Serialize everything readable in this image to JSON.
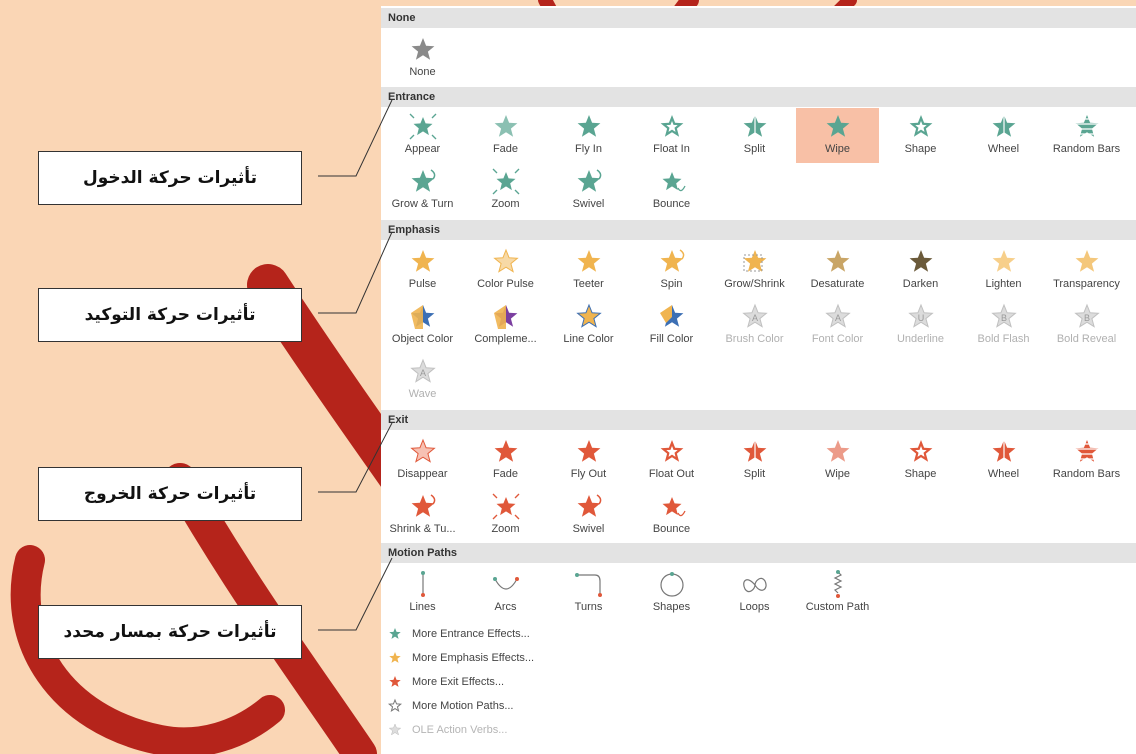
{
  "colors": {
    "entrance": "#5aa592",
    "emphasis": "#f0b44f",
    "exit": "#e0583a",
    "disabled": "#c8c8c8",
    "selected": "#f8c0a6",
    "watermark": "#b5241b"
  },
  "sections": {
    "none": {
      "title": "None",
      "items": [
        {
          "label": "None",
          "icon": "star-none-icon"
        }
      ]
    },
    "entrance": {
      "title": "Entrance",
      "items": [
        {
          "label": "Appear",
          "icon": "appear-icon"
        },
        {
          "label": "Fade",
          "icon": "fade-icon"
        },
        {
          "label": "Fly In",
          "icon": "fly-in-icon"
        },
        {
          "label": "Float In",
          "icon": "float-in-icon"
        },
        {
          "label": "Split",
          "icon": "split-icon"
        },
        {
          "label": "Wipe",
          "icon": "wipe-icon",
          "selected": true
        },
        {
          "label": "Shape",
          "icon": "shape-icon"
        },
        {
          "label": "Wheel",
          "icon": "wheel-icon"
        },
        {
          "label": "Random Bars",
          "icon": "random-bars-icon"
        },
        {
          "label": "Grow & Turn",
          "icon": "grow-turn-icon"
        },
        {
          "label": "Zoom",
          "icon": "zoom-icon"
        },
        {
          "label": "Swivel",
          "icon": "swivel-icon"
        },
        {
          "label": "Bounce",
          "icon": "bounce-icon"
        }
      ]
    },
    "emphasis": {
      "title": "Emphasis",
      "items": [
        {
          "label": "Pulse",
          "icon": "pulse-icon"
        },
        {
          "label": "Color Pulse",
          "icon": "color-pulse-icon"
        },
        {
          "label": "Teeter",
          "icon": "teeter-icon"
        },
        {
          "label": "Spin",
          "icon": "spin-icon"
        },
        {
          "label": "Grow/Shrink",
          "icon": "grow-shrink-icon"
        },
        {
          "label": "Desaturate",
          "icon": "desaturate-icon"
        },
        {
          "label": "Darken",
          "icon": "darken-icon"
        },
        {
          "label": "Lighten",
          "icon": "lighten-icon"
        },
        {
          "label": "Transparency",
          "icon": "transparency-icon"
        },
        {
          "label": "Object Color",
          "icon": "object-color-icon"
        },
        {
          "label": "Compleme...",
          "icon": "complementary-color-icon"
        },
        {
          "label": "Line Color",
          "icon": "line-color-icon"
        },
        {
          "label": "Fill Color",
          "icon": "fill-color-icon"
        },
        {
          "label": "Brush Color",
          "icon": "brush-color-icon",
          "disabled": true,
          "glyph": "A"
        },
        {
          "label": "Font Color",
          "icon": "font-color-icon",
          "disabled": true,
          "glyph": "A"
        },
        {
          "label": "Underline",
          "icon": "underline-icon",
          "disabled": true,
          "glyph": "U"
        },
        {
          "label": "Bold Flash",
          "icon": "bold-flash-icon",
          "disabled": true,
          "glyph": "B"
        },
        {
          "label": "Bold Reveal",
          "icon": "bold-reveal-icon",
          "disabled": true,
          "glyph": "B"
        },
        {
          "label": "Wave",
          "icon": "wave-icon",
          "disabled": true,
          "glyph": "A"
        }
      ]
    },
    "exit": {
      "title": "Exit",
      "items": [
        {
          "label": "Disappear",
          "icon": "disappear-icon"
        },
        {
          "label": "Fade",
          "icon": "fade-exit-icon"
        },
        {
          "label": "Fly Out",
          "icon": "fly-out-icon"
        },
        {
          "label": "Float Out",
          "icon": "float-out-icon"
        },
        {
          "label": "Split",
          "icon": "split-exit-icon"
        },
        {
          "label": "Wipe",
          "icon": "wipe-exit-icon"
        },
        {
          "label": "Shape",
          "icon": "shape-exit-icon"
        },
        {
          "label": "Wheel",
          "icon": "wheel-exit-icon"
        },
        {
          "label": "Random Bars",
          "icon": "random-bars-exit-icon"
        },
        {
          "label": "Shrink & Tu...",
          "icon": "shrink-turn-icon"
        },
        {
          "label": "Zoom",
          "icon": "zoom-exit-icon"
        },
        {
          "label": "Swivel",
          "icon": "swivel-exit-icon"
        },
        {
          "label": "Bounce",
          "icon": "bounce-exit-icon"
        }
      ]
    },
    "motion": {
      "title": "Motion Paths",
      "items": [
        {
          "label": "Lines",
          "icon": "lines-path-icon"
        },
        {
          "label": "Arcs",
          "icon": "arcs-path-icon"
        },
        {
          "label": "Turns",
          "icon": "turns-path-icon"
        },
        {
          "label": "Shapes",
          "icon": "shapes-path-icon"
        },
        {
          "label": "Loops",
          "icon": "loops-path-icon"
        },
        {
          "label": "Custom Path",
          "icon": "custom-path-icon"
        }
      ]
    }
  },
  "more_effects": [
    {
      "label": "More Entrance Effects...",
      "icon": "entrance-star-icon"
    },
    {
      "label": "More Emphasis Effects...",
      "icon": "emphasis-star-icon"
    },
    {
      "label": "More Exit Effects...",
      "icon": "exit-star-icon"
    },
    {
      "label": "More Motion Paths...",
      "icon": "motion-path-star-icon"
    },
    {
      "label": "OLE Action Verbs...",
      "icon": "ole-verbs-icon",
      "disabled": true
    }
  ],
  "callouts": [
    {
      "text": "تأثيرات حركة الدخول"
    },
    {
      "text": "تأثيرات حركة التوكيد"
    },
    {
      "text": "تأثيرات حركة الخروج"
    },
    {
      "text": "تأثيرات حركة بمسار محدد"
    }
  ]
}
